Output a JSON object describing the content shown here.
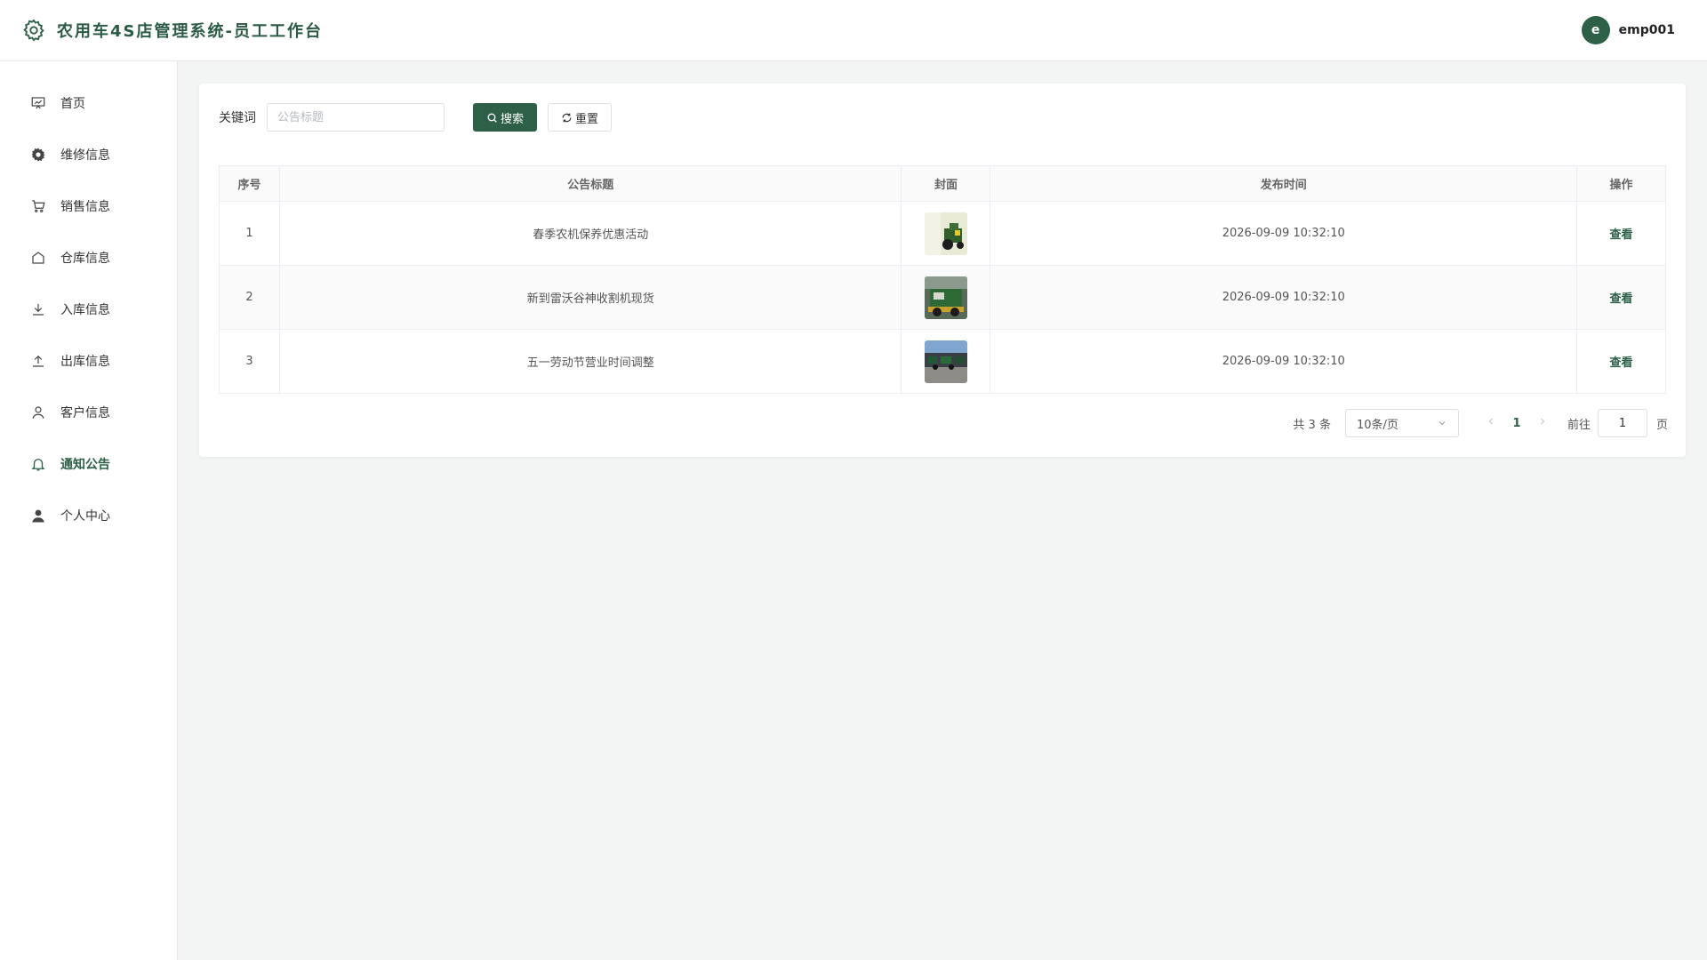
{
  "header": {
    "title": "农用车4S店管理系统-员工工作台",
    "logo_icon": "gear-icon",
    "user": {
      "avatar_letter": "e",
      "name": "emp001"
    }
  },
  "colors": {
    "accent": "#2e6048",
    "background": "#f3f5f4"
  },
  "sidebar": {
    "items": [
      {
        "label": "首页",
        "icon": "dashboard-icon",
        "active": false
      },
      {
        "label": "维修信息",
        "icon": "gear-icon",
        "active": false
      },
      {
        "label": "销售信息",
        "icon": "cart-icon",
        "active": false
      },
      {
        "label": "仓库信息",
        "icon": "house-icon",
        "active": false
      },
      {
        "label": "入库信息",
        "icon": "download-icon",
        "active": false
      },
      {
        "label": "出库信息",
        "icon": "upload-icon",
        "active": false
      },
      {
        "label": "客户信息",
        "icon": "user-icon",
        "active": false
      },
      {
        "label": "通知公告",
        "icon": "bell-icon",
        "active": true
      },
      {
        "label": "个人中心",
        "icon": "user-filled-icon",
        "active": false
      }
    ]
  },
  "search": {
    "label": "关键词",
    "placeholder": "公告标题",
    "value": "",
    "search_button": "搜索",
    "reset_button": "重置"
  },
  "table": {
    "headers": [
      "序号",
      "公告标题",
      "封面",
      "发布时间",
      "操作"
    ],
    "rows": [
      {
        "index": "1",
        "title": "春季农机保养优惠活动",
        "time": "2026-09-09 10:32:10",
        "action": "查看"
      },
      {
        "index": "2",
        "title": "新到雷沃谷神收割机现货",
        "time": "2026-09-09 10:32:10",
        "action": "查看"
      },
      {
        "index": "3",
        "title": "五一劳动节营业时间调整",
        "time": "2026-09-09 10:32:10",
        "action": "查看"
      }
    ]
  },
  "pagination": {
    "total_text": "共 3 条",
    "page_size": "10条/页",
    "current_page": "1",
    "goto_label": "前往",
    "goto_value": "1",
    "goto_suffix": "页"
  }
}
